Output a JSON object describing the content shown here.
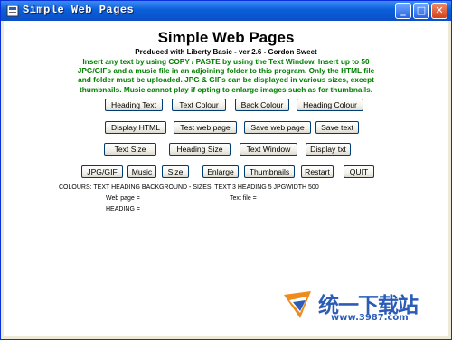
{
  "window": {
    "title": "Simple Web Pages",
    "minimize_glyph": "_",
    "maximize_glyph": "□",
    "close_glyph": "✕"
  },
  "header": {
    "title": "Simple Web Pages",
    "subtitle": "Produced with Liberty Basic - ver 2.6 - Gordon Sweet"
  },
  "instructions": "Insert any text by using COPY / PASTE by using the Text Window. Insert up to 50 JPG/GIFs and a music file in an adjoining folder to this program. Only the HTML file and folder must be uploaded. JPG & GIFs can be displayed in various sizes, except thumbnails. Music cannot play if opting to enlarge images such as for thumbnails.",
  "buttons": {
    "heading_text": "Heading Text",
    "text_colour": "Text Colour",
    "back_colour": "Back Colour",
    "heading_colour": "Heading Colour",
    "display_html": "Display HTML",
    "test_web_page": "Test web page",
    "save_web_page": "Save web page",
    "save_text": "Save text",
    "text_size": "Text Size",
    "heading_size": "Heading Size",
    "text_window": "Text Window",
    "display_txt": "Display txt",
    "jpg_gif": "JPG/GIF",
    "music": "Music",
    "size": "Size",
    "enlarge": "Enlarge",
    "thumbnails": "Thumbnails",
    "restart": "Restart",
    "quit": "QUIT"
  },
  "status": {
    "colours_line": "COLOURS: TEXT HEADING BACKGROUND - SIZES: TEXT 3 HEADING 5 JPGWIDTH 500",
    "web_page_label": "Web page =",
    "text_file_label": "Text file =",
    "heading_label": "HEADING ="
  },
  "watermark": {
    "brand": "统一下载站",
    "url": "www.3987.com",
    "colors": {
      "brand": "#2a5cb8",
      "logo_orange": "#f08a1c",
      "logo_blue": "#2a5cb8"
    }
  },
  "colors": {
    "title_bar": "#0a5fd8",
    "instructions_text": "#008000",
    "client_background": "#ffffff"
  }
}
